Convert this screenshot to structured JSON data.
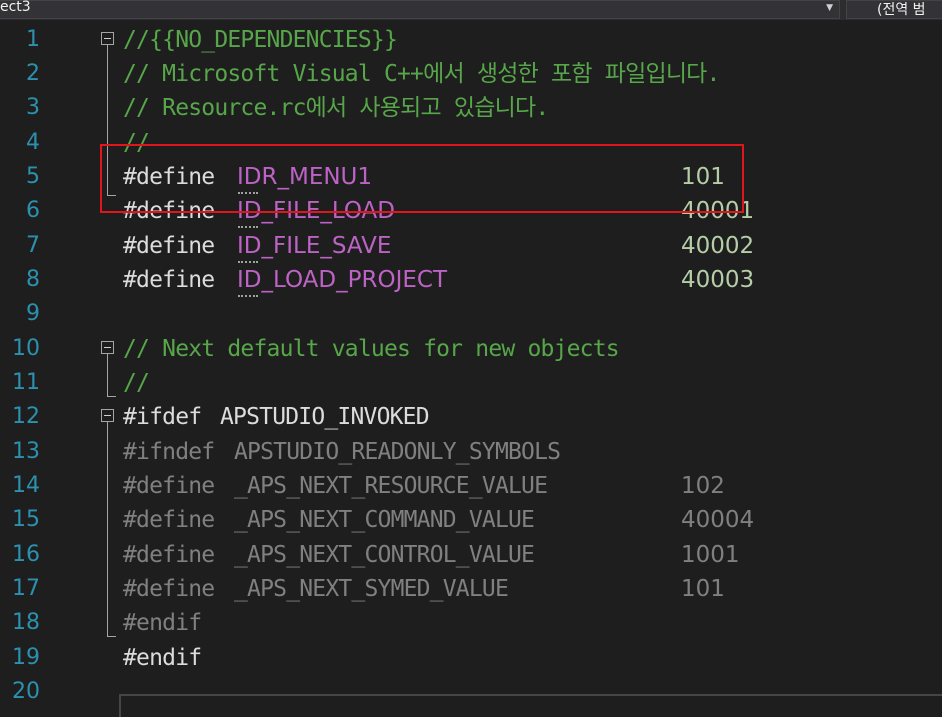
{
  "toolbar": {
    "project_label": "ect3",
    "scope_label": "(전역 범",
    "dropdown_icon": "chevron-down-icon"
  },
  "editor": {
    "line_numbers": [
      "1",
      "2",
      "3",
      "4",
      "5",
      "6",
      "7",
      "8",
      "9",
      "10",
      "11",
      "12",
      "13",
      "14",
      "15",
      "16",
      "17",
      "18",
      "19",
      "20"
    ],
    "lines": {
      "l1": "//{{NO_DEPENDENCIES}}",
      "l2": "// Microsoft Visual C++에서 생성한 포함 파일입니다.",
      "l3": "// Resource.rc에서 사용되고 있습니다.",
      "l4": "//",
      "l5_kw": "#define",
      "l5_sym": "IDR_MENU1",
      "l5_val": "101",
      "l6_kw": "#define",
      "l6_sym": "ID_FILE_LOAD",
      "l6_val": "40001",
      "l7_kw": "#define",
      "l7_sym": "ID_FILE_SAVE",
      "l7_val": "40002",
      "l8_kw": "#define",
      "l8_sym": "ID_LOAD_PROJECT",
      "l8_val": "40003",
      "l10": "// Next default values for new objects",
      "l11": "//",
      "l12_kw": "#ifdef",
      "l12_sym": "APSTUDIO_INVOKED",
      "l13_kw": "#ifndef",
      "l13_sym": "APSTUDIO_READONLY_SYMBOLS",
      "l14_kw": "#define",
      "l14_sym": "_APS_NEXT_RESOURCE_VALUE",
      "l14_val": "102",
      "l15_kw": "#define",
      "l15_sym": "_APS_NEXT_COMMAND_VALUE",
      "l15_val": "40004",
      "l16_kw": "#define",
      "l16_sym": "_APS_NEXT_CONTROL_VALUE",
      "l16_val": "1001",
      "l17_kw": "#define",
      "l17_sym": "_APS_NEXT_SYMED_VALUE",
      "l17_val": "101",
      "l18": "#endif",
      "l19": "#endif"
    }
  },
  "colors": {
    "background": "#1e1e1e",
    "line_number": "#2b91af",
    "comment": "#57a64a",
    "highlight_border": "#e0161c",
    "inactive_code": "#808080"
  }
}
